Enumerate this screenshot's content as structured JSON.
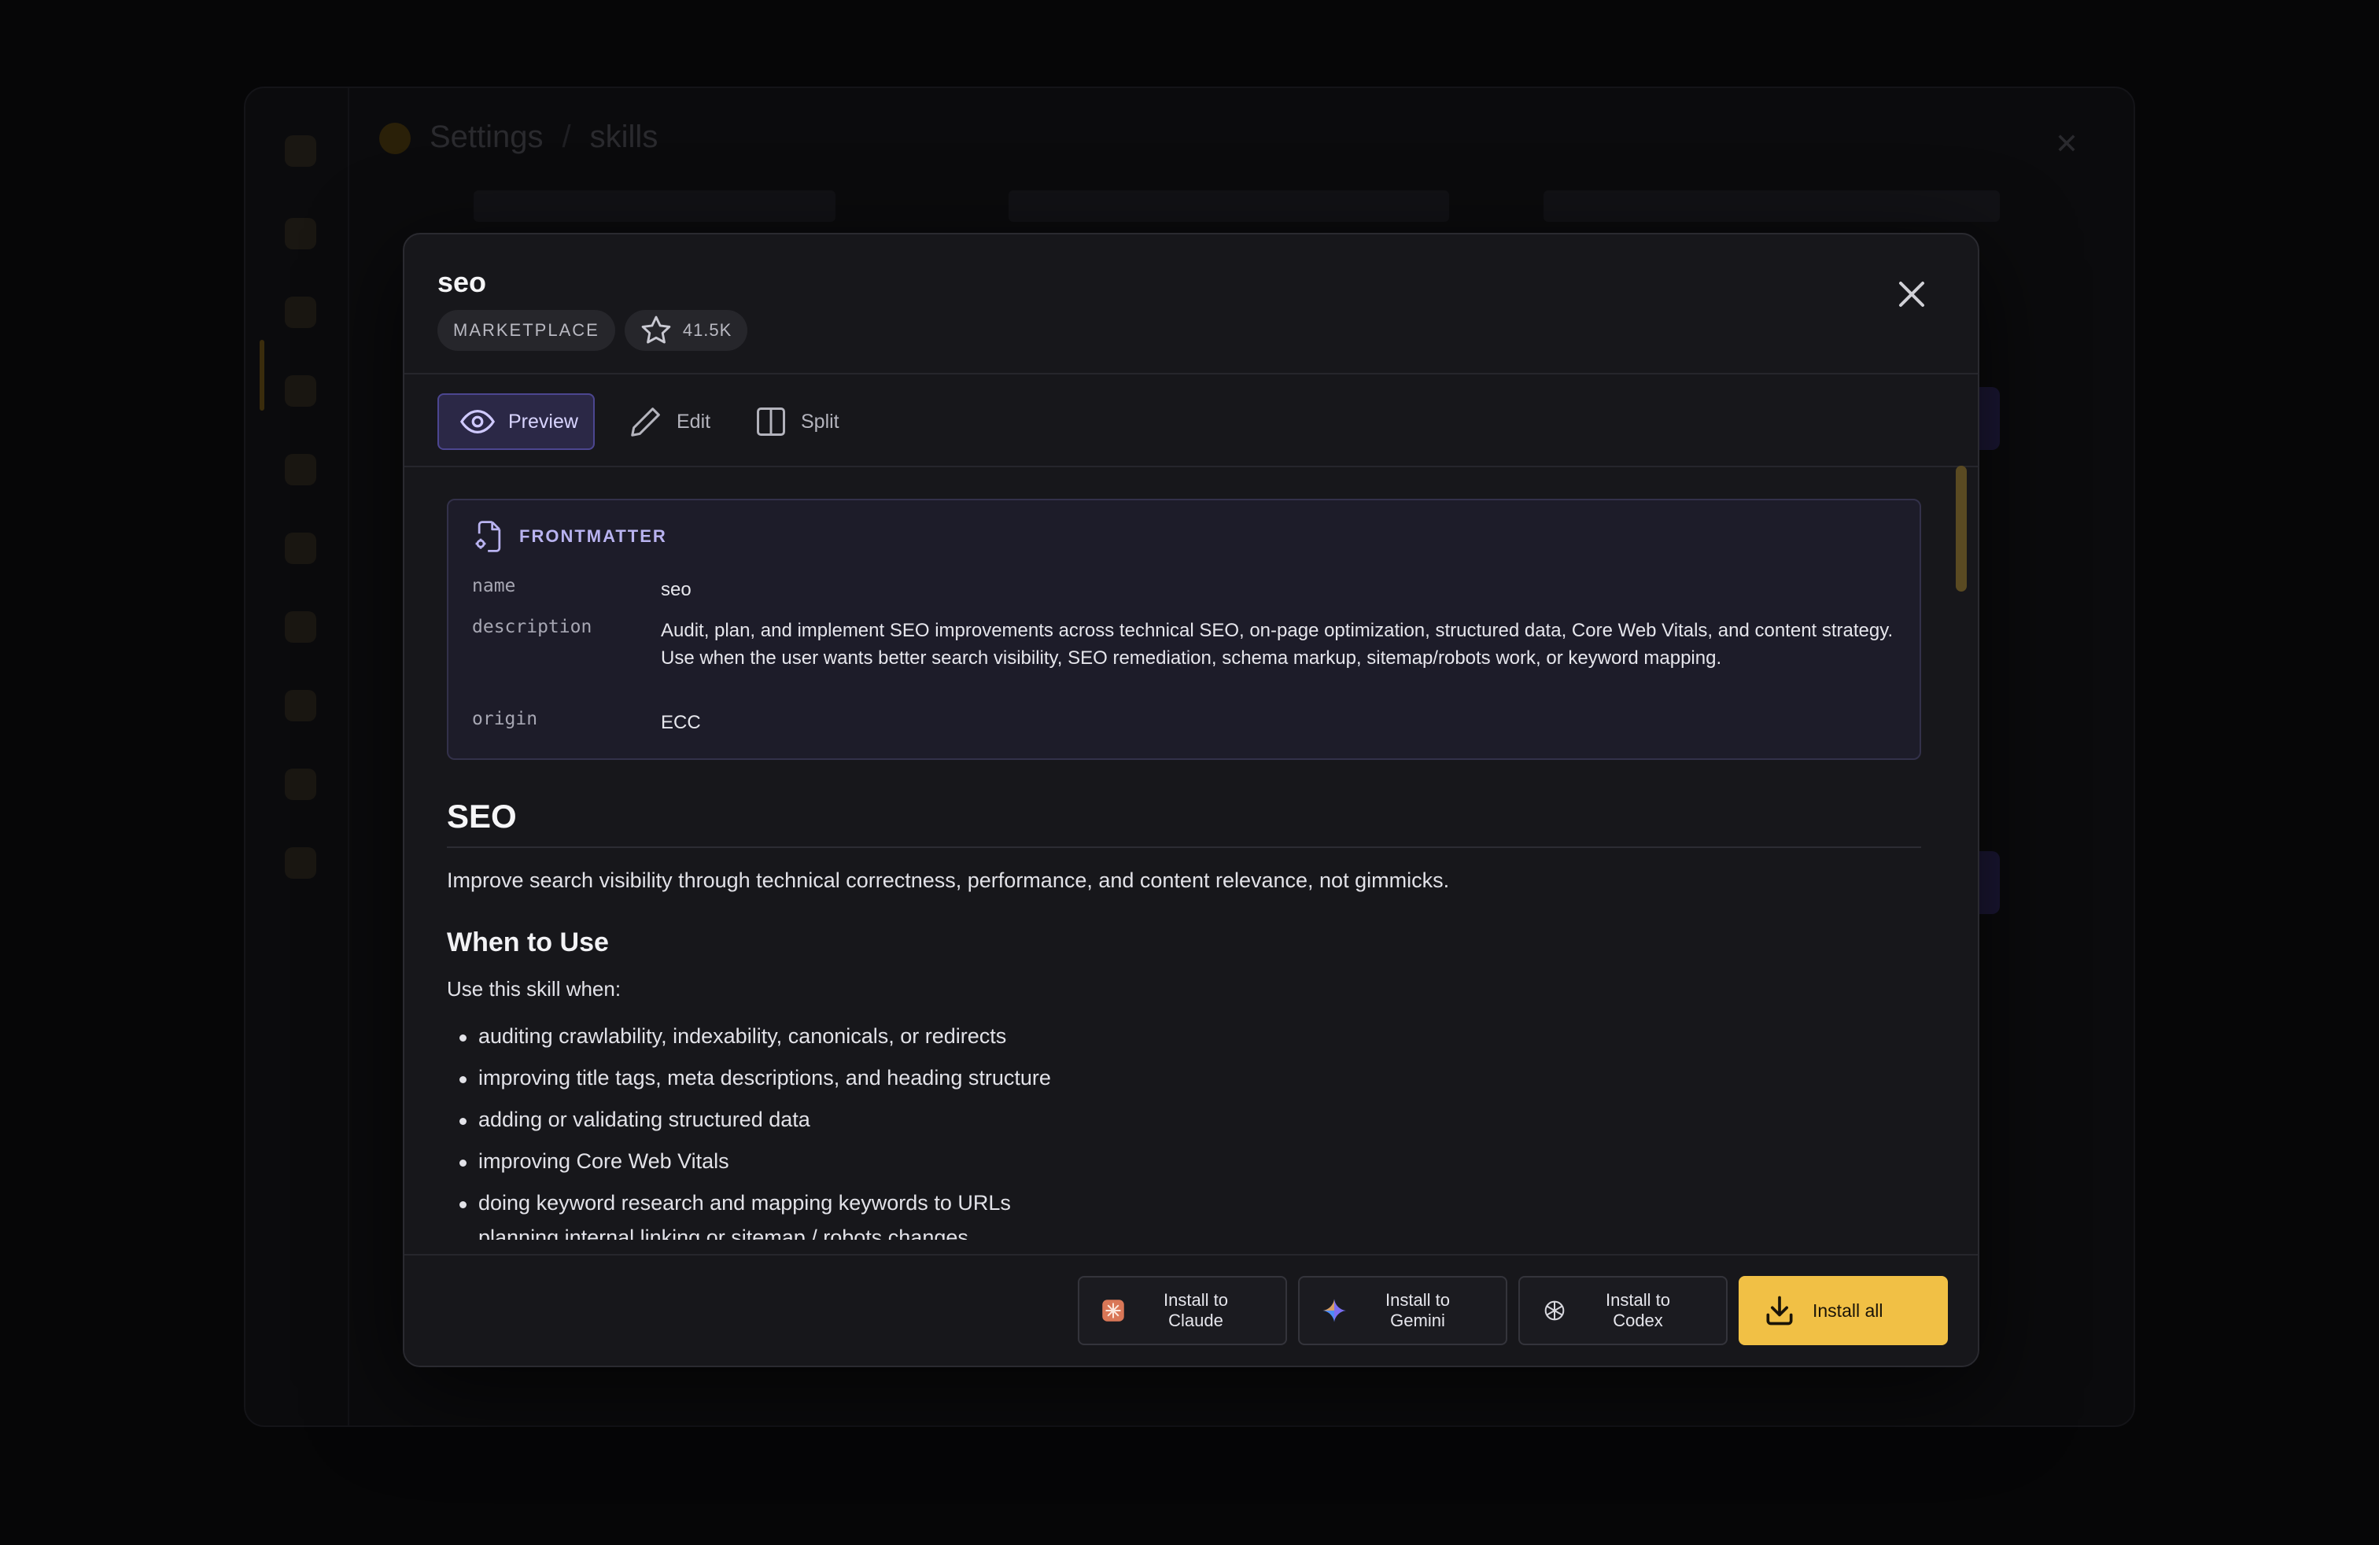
{
  "background": {
    "breadcrumb_root": "Settings",
    "breadcrumb_current": "skills"
  },
  "modal": {
    "title": "seo",
    "source_badge": "MARKETPLACE",
    "stars": "41.5K",
    "tabs": [
      {
        "label": "Preview",
        "icon": "eye-icon",
        "active": true
      },
      {
        "label": "Edit",
        "icon": "pencil-icon",
        "active": false
      },
      {
        "label": "Split",
        "icon": "split-icon",
        "active": false
      }
    ],
    "frontmatter": {
      "heading": "FRONTMATTER",
      "rows": [
        {
          "key": "name",
          "value": "seo"
        },
        {
          "key": "description",
          "value": "Audit, plan, and implement SEO improvements across technical SEO, on-page optimization, structured data, Core Web Vitals, and content strategy. Use when the user wants better search visibility, SEO remediation, schema markup, sitemap/robots work, or keyword mapping."
        },
        {
          "key": "origin",
          "value": "ECC"
        }
      ]
    },
    "document": {
      "h1": "SEO",
      "intro": "Improve search visibility through technical correctness, performance, and content relevance, not gimmicks.",
      "h2": "When to Use",
      "lead": "Use this skill when:",
      "bullets": [
        "auditing crawlability, indexability, canonicals, or redirects",
        "improving title tags, meta descriptions, and heading structure",
        "adding or validating structured data",
        "improving Core Web Vitals",
        "doing keyword research and mapping keywords to URLs",
        "planning internal linking or sitemap / robots changes"
      ]
    },
    "footer": {
      "claude": "Install to Claude",
      "gemini": "Install to Gemini",
      "codex": "Install to Codex",
      "all": "Install all"
    }
  },
  "colors": {
    "accent": "#f1c045",
    "active_tab": "#2b2846",
    "claude_brand": "#d97757"
  }
}
